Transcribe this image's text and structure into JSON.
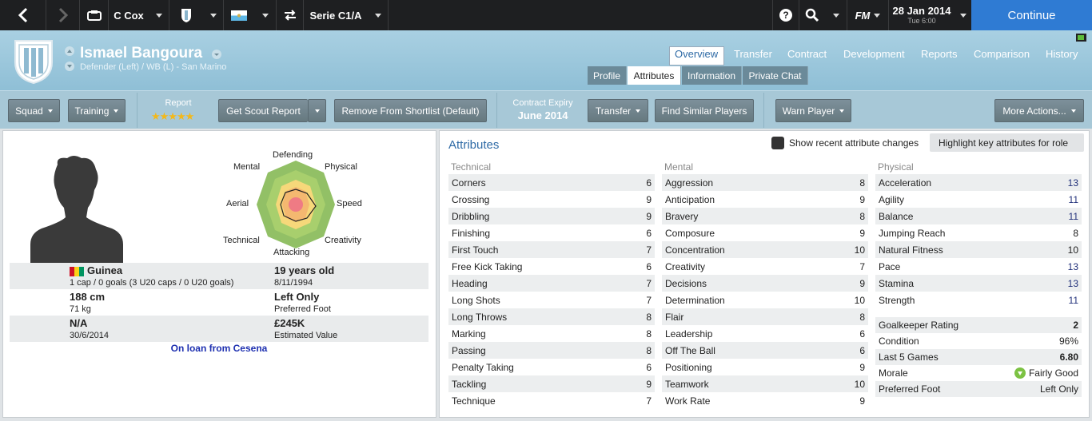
{
  "topbar": {
    "manager": "C Cox",
    "competition": "Serie C1/A",
    "date": "28 Jan 2014",
    "day_time": "Tue 6:00",
    "fm_label": "FM",
    "continue_label": "Continue"
  },
  "header": {
    "player_name": "Ismael Bangoura",
    "player_position": "Defender (Left) / WB (L) - San Marino",
    "nav_tabs": [
      "Overview",
      "Transfer",
      "Contract",
      "Development",
      "Reports",
      "Comparison",
      "History"
    ],
    "active_nav": "Overview",
    "sub_tabs": [
      "Profile",
      "Attributes",
      "Information",
      "Private Chat"
    ],
    "active_sub": "Attributes"
  },
  "actions": {
    "squad": "Squad",
    "training": "Training",
    "report_label": "Report",
    "report_stars": 5,
    "get_scout_report": "Get Scout Report",
    "remove_shortlist": "Remove From Shortlist (Default)",
    "contract_expiry_label": "Contract Expiry",
    "contract_expiry_value": "June 2014",
    "transfer": "Transfer",
    "find_similar": "Find Similar Players",
    "warn_player": "Warn Player",
    "more_actions": "More Actions..."
  },
  "profile": {
    "radar_labels": {
      "top": "Defending",
      "top_right": "Physical",
      "right": "Speed",
      "bottom_right": "Creativity",
      "bottom": "Attacking",
      "bottom_left": "Technical",
      "left": "Aerial",
      "top_left": "Mental"
    },
    "nationality": "Guinea",
    "caps": "1 cap / 0 goals (3 U20 caps / 0 U20 goals)",
    "age": "19 years old",
    "dob": "8/11/1994",
    "height": "188 cm",
    "weight": "71 kg",
    "foot": "Left Only",
    "foot_label": "Preferred Foot",
    "wage": "N/A",
    "contract_end": "30/6/2014",
    "value": "£245K",
    "value_label": "Estimated Value",
    "loan_text": "On loan from Cesena"
  },
  "attributes": {
    "title": "Attributes",
    "show_changes_label": "Show recent attribute changes",
    "highlight_label": "Highlight key attributes for role",
    "technical_head": "Technical",
    "mental_head": "Mental",
    "physical_head": "Physical",
    "technical": [
      {
        "name": "Corners",
        "value": "6"
      },
      {
        "name": "Crossing",
        "value": "9"
      },
      {
        "name": "Dribbling",
        "value": "9"
      },
      {
        "name": "Finishing",
        "value": "6"
      },
      {
        "name": "First Touch",
        "value": "7"
      },
      {
        "name": "Free Kick Taking",
        "value": "6"
      },
      {
        "name": "Heading",
        "value": "7"
      },
      {
        "name": "Long Shots",
        "value": "7"
      },
      {
        "name": "Long Throws",
        "value": "8"
      },
      {
        "name": "Marking",
        "value": "8"
      },
      {
        "name": "Passing",
        "value": "8"
      },
      {
        "name": "Penalty Taking",
        "value": "6"
      },
      {
        "name": "Tackling",
        "value": "9"
      },
      {
        "name": "Technique",
        "value": "7"
      }
    ],
    "mental": [
      {
        "name": "Aggression",
        "value": "8"
      },
      {
        "name": "Anticipation",
        "value": "9"
      },
      {
        "name": "Bravery",
        "value": "8"
      },
      {
        "name": "Composure",
        "value": "9"
      },
      {
        "name": "Concentration",
        "value": "10"
      },
      {
        "name": "Creativity",
        "value": "7"
      },
      {
        "name": "Decisions",
        "value": "9"
      },
      {
        "name": "Determination",
        "value": "10"
      },
      {
        "name": "Flair",
        "value": "8"
      },
      {
        "name": "Leadership",
        "value": "6"
      },
      {
        "name": "Off The Ball",
        "value": "6"
      },
      {
        "name": "Positioning",
        "value": "9"
      },
      {
        "name": "Teamwork",
        "value": "10"
      },
      {
        "name": "Work Rate",
        "value": "9"
      }
    ],
    "physical": [
      {
        "name": "Acceleration",
        "value": "13"
      },
      {
        "name": "Agility",
        "value": "11"
      },
      {
        "name": "Balance",
        "value": "11"
      },
      {
        "name": "Jumping Reach",
        "value": "8"
      },
      {
        "name": "Natural Fitness",
        "value": "10"
      },
      {
        "name": "Pace",
        "value": "13"
      },
      {
        "name": "Stamina",
        "value": "13"
      },
      {
        "name": "Strength",
        "value": "11"
      }
    ],
    "physical_highlight": [
      "13",
      "11",
      "11",
      "",
      "",
      "13",
      "13",
      "11"
    ],
    "summary": [
      {
        "name": "Goalkeeper Rating",
        "value": "2"
      },
      {
        "name": "Condition",
        "value": "96%"
      },
      {
        "name": "Last 5 Games",
        "value": "6.80"
      },
      {
        "name": "Morale",
        "value": "Fairly Good"
      },
      {
        "name": "Preferred Foot",
        "value": "Left Only"
      }
    ]
  },
  "colors": {
    "accent": "#2f7bd3",
    "highlight_value": "#21307a",
    "header": "#9cc6da"
  }
}
